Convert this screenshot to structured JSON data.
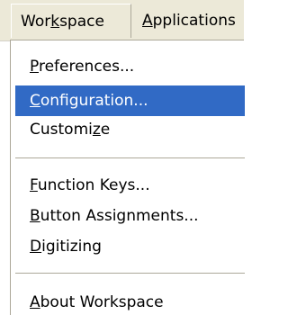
{
  "menubar": {
    "items": [
      {
        "pre": "Wor",
        "accel": "k",
        "post": "space"
      },
      {
        "pre": "",
        "accel": "A",
        "post": "pplications"
      }
    ]
  },
  "dropdown": {
    "items": [
      {
        "pre": "",
        "accel": "P",
        "post": "references..."
      },
      {
        "pre": "",
        "accel": "C",
        "post": "onfiguration..."
      },
      {
        "pre": "Customi",
        "accel": "z",
        "post": "e"
      },
      {
        "pre": "",
        "accel": "F",
        "post": "unction Keys..."
      },
      {
        "pre": "",
        "accel": "B",
        "post": "utton Assignments..."
      },
      {
        "pre": "",
        "accel": "D",
        "post": "igitizing"
      },
      {
        "pre": "",
        "accel": "A",
        "post": "bout Workspace"
      }
    ]
  },
  "colors": {
    "menubar_bg": "#ece9d8",
    "highlight_bg": "#316ac5",
    "highlight_text": "#ffffff",
    "separator": "#aca899"
  }
}
